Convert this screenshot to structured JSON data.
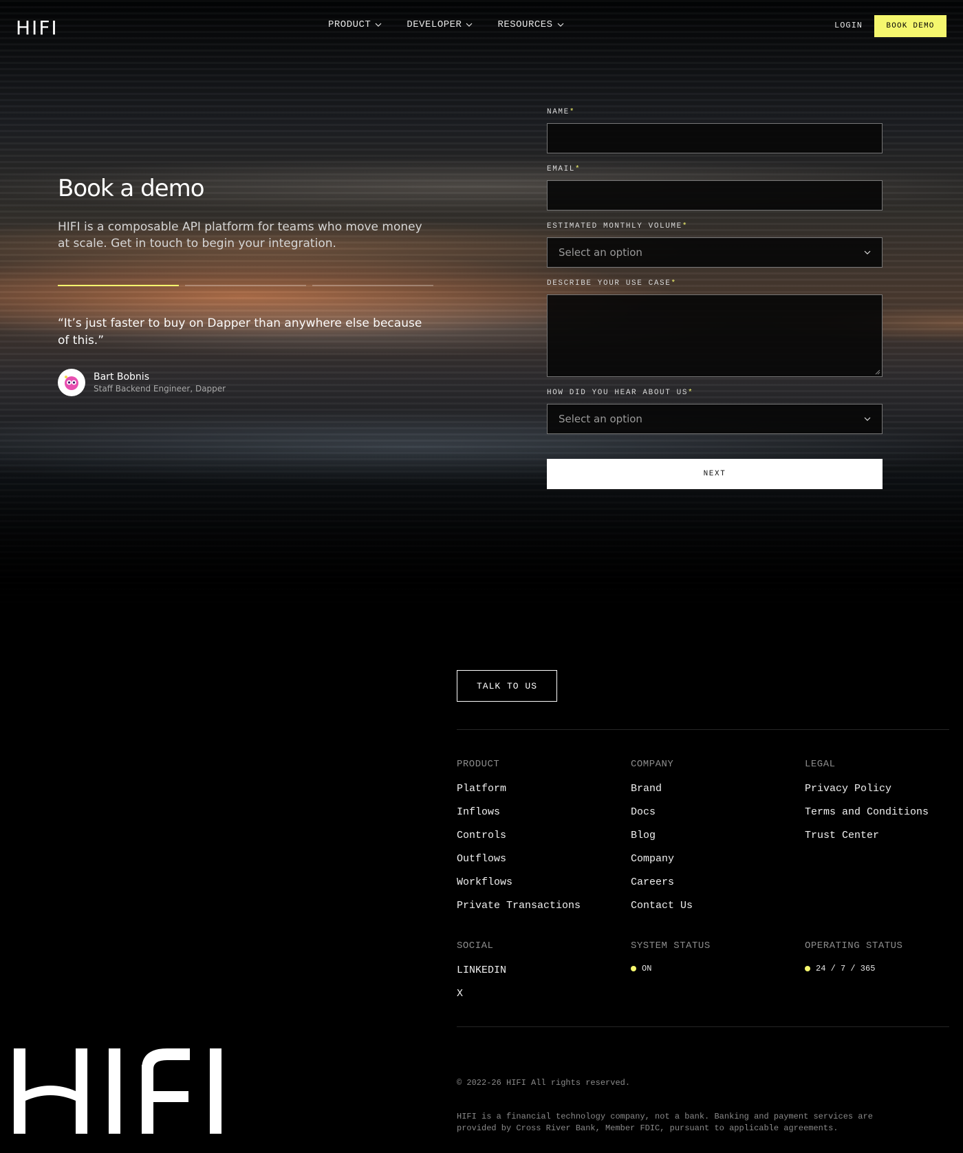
{
  "header": {
    "logo": "HIFI",
    "nav": [
      {
        "label": "PRODUCT"
      },
      {
        "label": "DEVELOPER"
      },
      {
        "label": "RESOURCES"
      }
    ],
    "login": "LOGIN",
    "book_demo": "BOOK DEMO"
  },
  "hero": {
    "title": "Book a demo",
    "subtitle": "HIFI is a composable API platform for teams who move money at scale. Get in touch to begin your integration.",
    "quote": "“It’s just faster to buy on Dapper than anywhere else because of this.”",
    "author_name": "Bart Bobnis",
    "author_role": "Staff Backend Engineer, Dapper",
    "progress_active_index": 0
  },
  "form": {
    "name_label": "NAME",
    "email_label": "EMAIL",
    "volume_label": "ESTIMATED MONTHLY VOLUME",
    "volume_placeholder": "Select an option",
    "usecase_label": "DESCRIBE YOUR USE CASE",
    "hear_label": "HOW DID YOU HEAR ABOUT US",
    "hear_placeholder": "Select an option",
    "required_mark": "*",
    "next": "NEXT"
  },
  "footer": {
    "talk": "TALK TO US",
    "product": {
      "heading": "PRODUCT",
      "links": [
        "Platform",
        "Inflows",
        "Controls",
        "Outflows",
        "Workflows",
        "Private Transactions"
      ]
    },
    "company": {
      "heading": "COMPANY",
      "links": [
        "Brand",
        "Docs",
        "Blog",
        "Company",
        "Careers",
        "Contact Us"
      ]
    },
    "legal": {
      "heading": "LEGAL",
      "links": [
        "Privacy Policy",
        "Terms and Conditions",
        "Trust Center"
      ]
    },
    "social": {
      "heading": "SOCIAL",
      "links": [
        "LINKEDIN",
        "X"
      ]
    },
    "system_status": {
      "heading": "SYSTEM STATUS",
      "value": "ON"
    },
    "operating_status": {
      "heading": "OPERATING STATUS",
      "value": "24 / 7 / 365"
    },
    "copyright": "© 2022-26 HIFI All rights reserved.",
    "disclaimer": "HIFI is a financial technology company, not a bank. Banking and payment services are provided by Cross River Bank, Member FDIC, pursuant to applicable agreements.",
    "big_logo": "HIFI"
  },
  "colors": {
    "accent": "#f5f76e",
    "background": "#000000"
  }
}
